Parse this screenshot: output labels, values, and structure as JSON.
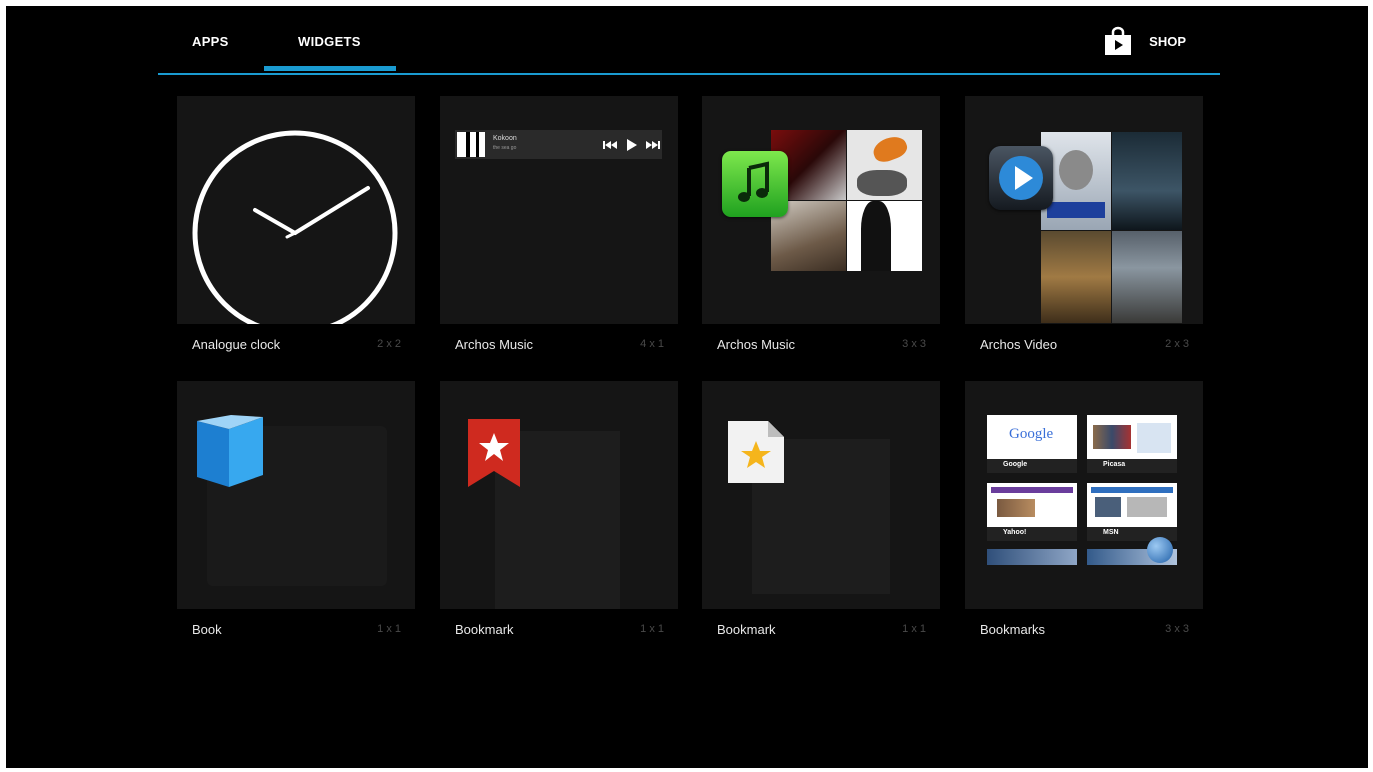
{
  "tabs": {
    "apps": "APPS",
    "widgets": "WIDGETS",
    "shop": "SHOP",
    "active": "WIDGETS"
  },
  "colors": {
    "accent": "#1a9bd1",
    "background": "#000000",
    "card": "#151515"
  },
  "widgets": [
    {
      "name": "Analogue clock",
      "dims": "2 x 2",
      "icon": "analog-clock-icon"
    },
    {
      "name": "Archos Music",
      "dims": "4 x 1",
      "icon": "music-player-bar-icon",
      "player": {
        "title": "Kokoon",
        "subtitle": "the sea go"
      }
    },
    {
      "name": "Archos Music",
      "dims": "3 x 3",
      "icon": "music-note-icon"
    },
    {
      "name": "Archos Video",
      "dims": "2 x 3",
      "icon": "video-play-icon"
    },
    {
      "name": "Book",
      "dims": "1 x 1",
      "icon": "book-icon"
    },
    {
      "name": "Bookmark",
      "dims": "1 x 1",
      "icon": "bookmark-ribbon-icon"
    },
    {
      "name": "Bookmark",
      "dims": "1 x 1",
      "icon": "bookmark-file-icon"
    },
    {
      "name": "Bookmarks",
      "dims": "3 x 3",
      "icon": "bookmarks-grid-icon",
      "sites": [
        "Google",
        "Picasa",
        "Yahoo!",
        "MSN"
      ],
      "google_logo": "Google"
    }
  ]
}
